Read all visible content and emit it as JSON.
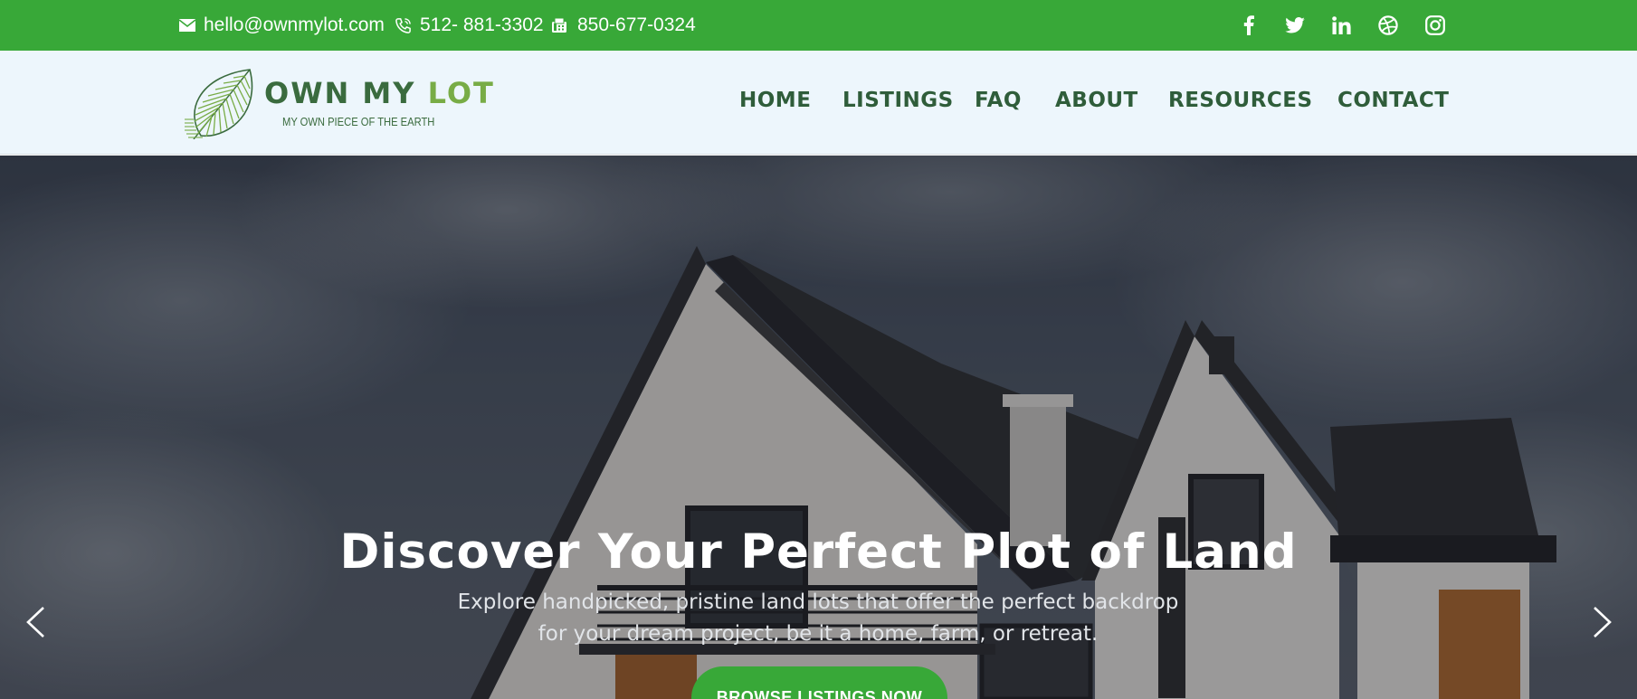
{
  "topbar": {
    "email": "hello@ownmylot.com",
    "phone": "512- 881-3302",
    "fax": "850-677-0324",
    "background": "#38a838",
    "social": [
      "facebook-icon",
      "twitter-icon",
      "linkedin-icon",
      "dribbble-icon",
      "instagram-icon"
    ]
  },
  "logo": {
    "name_own": "OWN MY",
    "name_lot": "LOT",
    "tagline": "MY OWN PIECE OF THE EARTH"
  },
  "nav": {
    "items": [
      {
        "label": "HOME"
      },
      {
        "label": "LISTINGS"
      },
      {
        "label": "FAQ"
      },
      {
        "label": "ABOUT"
      },
      {
        "label": "RESOURCES"
      },
      {
        "label": "CONTACT"
      }
    ],
    "color": "#2f5d3a"
  },
  "hero": {
    "title": "Discover Your Perfect Plot of Land",
    "subtitle": "Explore handpicked, pristine land lots that offer the perfect backdrop for your dream project, be it a home, farm, or retreat.",
    "cta": "BROWSE LISTINGS NOW",
    "prev_icon": "chevron-left-icon",
    "next_icon": "chevron-right-icon"
  }
}
